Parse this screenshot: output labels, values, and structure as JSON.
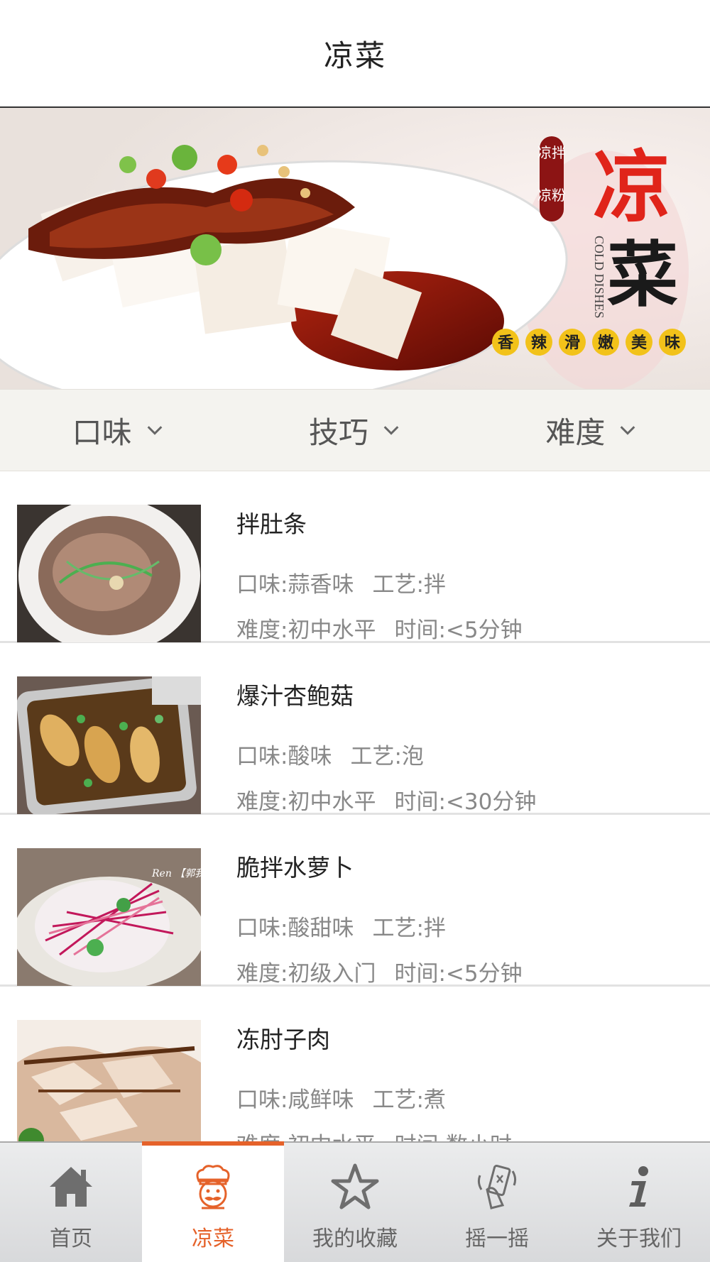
{
  "header": {
    "title": "凉菜"
  },
  "banner": {
    "badge": "凉拌凉粉",
    "big_char_1": "凉",
    "big_char_2": "菜",
    "english": "COLD DISHES",
    "tagline": [
      "香",
      "辣",
      "滑",
      "嫩",
      "美",
      "味"
    ]
  },
  "filters": [
    {
      "label": "口味"
    },
    {
      "label": "技巧"
    },
    {
      "label": "难度"
    }
  ],
  "items": [
    {
      "name": "拌肚条",
      "taste": "口味:蒜香味",
      "craft": "工艺:拌",
      "difficulty": "难度:初中水平",
      "time": "时间:<5分钟"
    },
    {
      "name": "爆汁杏鲍菇",
      "taste": "口味:酸味",
      "craft": "工艺:泡",
      "difficulty": "难度:初中水平",
      "time": "时间:<30分钟"
    },
    {
      "name": "脆拌水萝卜",
      "taste": "口味:酸甜味",
      "craft": "工艺:拌",
      "difficulty": "难度:初级入门",
      "time": "时间:<5分钟",
      "thumb_watermark": "Ren 【郭我的美食园】 Delicious"
    },
    {
      "name": "冻肘子肉",
      "taste": "口味:咸鲜味",
      "craft": "工艺:煮",
      "difficulty": "难度:初中水平",
      "time": "时间:数小时"
    }
  ],
  "tabs": [
    {
      "label": "首页",
      "icon": "home-icon"
    },
    {
      "label": "凉菜",
      "icon": "chef-icon",
      "active": true
    },
    {
      "label": "我的收藏",
      "icon": "star-icon"
    },
    {
      "label": "摇一摇",
      "icon": "shake-icon"
    },
    {
      "label": "关于我们",
      "icon": "info-icon"
    }
  ],
  "colors": {
    "accent": "#e5622a",
    "tab_bg": "#e0e1e3",
    "filter_bg": "#f4f3ef"
  }
}
